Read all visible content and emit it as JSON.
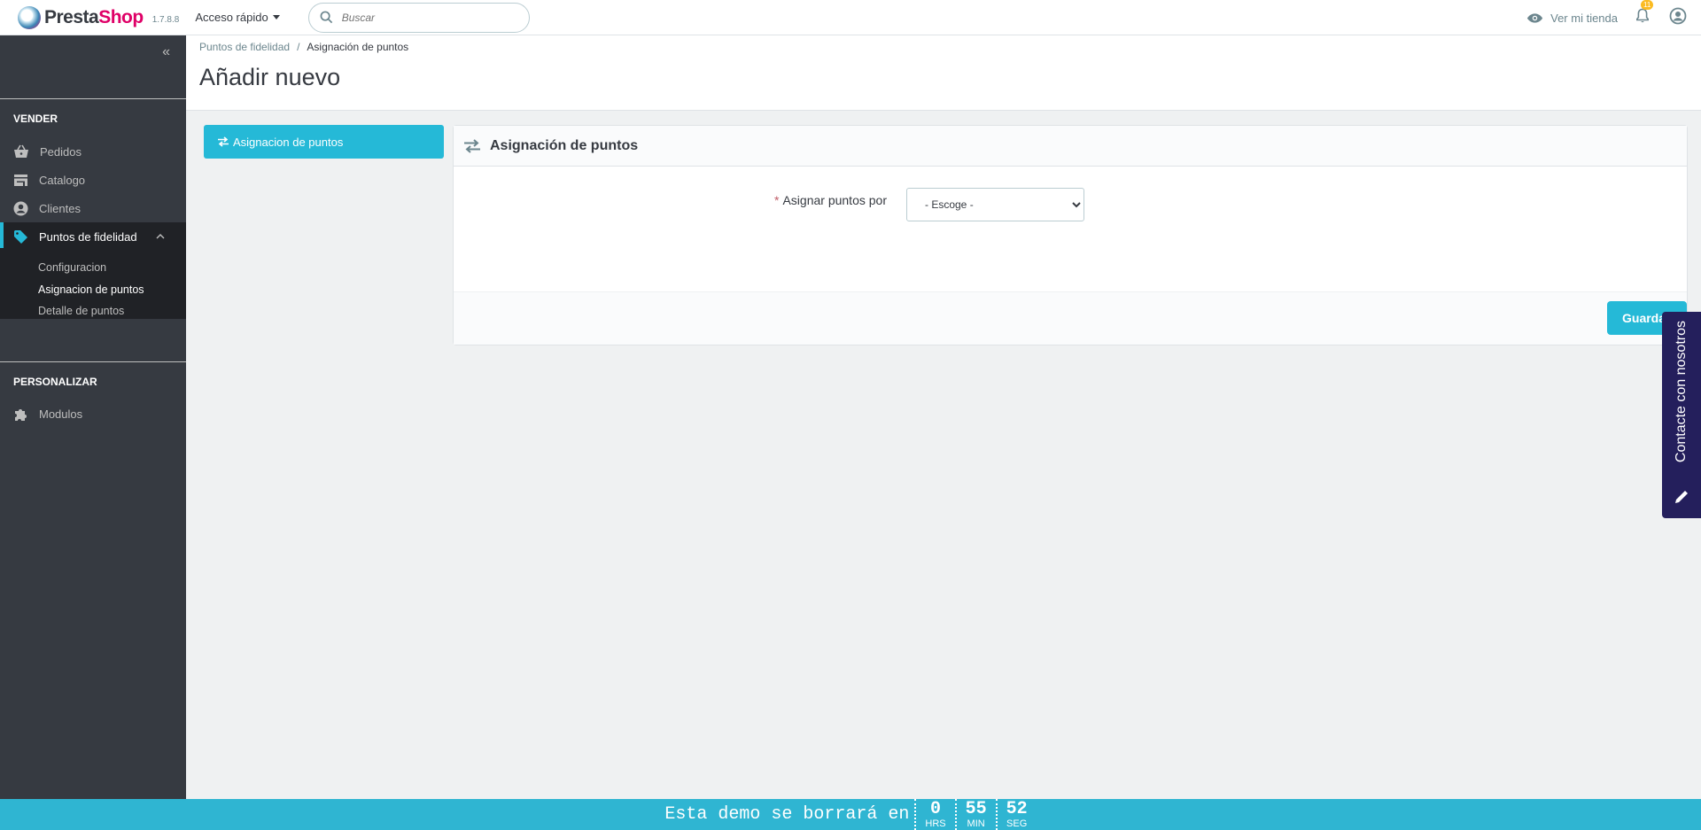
{
  "header": {
    "logo_part1": "Presta",
    "logo_part2": "Shop",
    "version": "1.7.8.8",
    "quick_access": "Acceso rápido",
    "search_placeholder": "Buscar",
    "view_store": "Ver mi tienda",
    "notification_count": "11"
  },
  "sidebar": {
    "section_sell": "VENDER",
    "items": [
      {
        "label": "Pedidos",
        "icon": "basket-icon"
      },
      {
        "label": "Catalogo",
        "icon": "store-icon"
      },
      {
        "label": "Clientes",
        "icon": "user-circle-icon"
      },
      {
        "label": "Puntos de fidelidad",
        "icon": "tag-icon"
      }
    ],
    "sub_items": [
      "Configuracion",
      "Asignacion de puntos",
      "Detalle de puntos"
    ],
    "section_customize": "PERSONALIZAR",
    "modules": "Modulos"
  },
  "page": {
    "breadcrumb_parent": "Puntos de fidelidad",
    "breadcrumb_current": "Asignación de puntos",
    "title": "Añadir nuevo"
  },
  "tab": {
    "label": "Asignacion de puntos"
  },
  "panel": {
    "heading": "Asignación de puntos",
    "field_label": "Asignar puntos por",
    "required_mark": "*",
    "select_value": "- Escoge -",
    "save_label": "Guardar"
  },
  "contact": {
    "label": "Contacte con nosotros"
  },
  "demo": {
    "text": "Esta demo se borrará en",
    "hours": "0",
    "hours_unit": "HRS",
    "minutes": "55",
    "minutes_unit": "MIN",
    "seconds": "52",
    "seconds_unit": "SEG"
  },
  "colors": {
    "accent": "#25b9d7",
    "sidebar": "#363a41",
    "brand": "#df0067",
    "contact": "#241f5c"
  }
}
